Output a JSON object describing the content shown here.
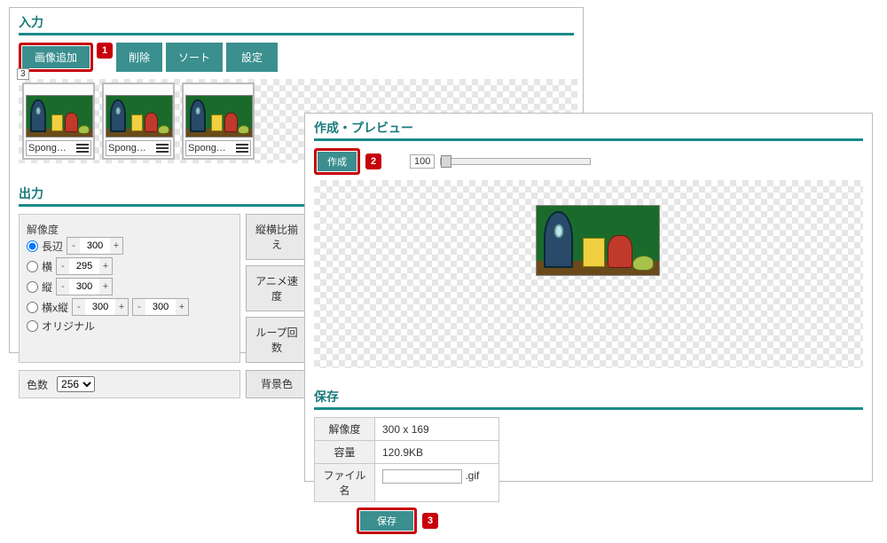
{
  "input": {
    "title": "入力",
    "buttons": {
      "add": "画像追加",
      "delete": "削除",
      "sort": "ソート",
      "settings": "設定"
    },
    "thumb_count_label": "3",
    "thumbs": [
      {
        "name": "Spong…"
      },
      {
        "name": "Spong…"
      },
      {
        "name": "Spong…"
      }
    ]
  },
  "output": {
    "title": "出力",
    "resolution_label": "解像度",
    "radios": {
      "long": "長辺",
      "width": "横",
      "height": "縦",
      "wh": "横x縦",
      "original": "オリジナル"
    },
    "vals": {
      "long": "300",
      "width": "295",
      "height": "300",
      "wh_w": "300",
      "wh_h": "300"
    },
    "side_buttons": {
      "aspect": "縦横比揃え",
      "anim": "アニメ速度",
      "loop": "ループ回数",
      "bg": "背景色"
    },
    "colors_label": "色数",
    "colors_value": "256"
  },
  "preview": {
    "title": "作成・プレビュー",
    "make_btn": "作成",
    "slider_value": "100"
  },
  "save": {
    "title": "保存",
    "rows": {
      "res_label": "解像度",
      "res_value": "300 x 169",
      "size_label": "容量",
      "size_value": "120.9KB",
      "file_label": "ファイル名",
      "ext": ".gif"
    },
    "save_btn": "保存"
  },
  "badges": {
    "b1": "1",
    "b2": "2",
    "b3": "3"
  }
}
